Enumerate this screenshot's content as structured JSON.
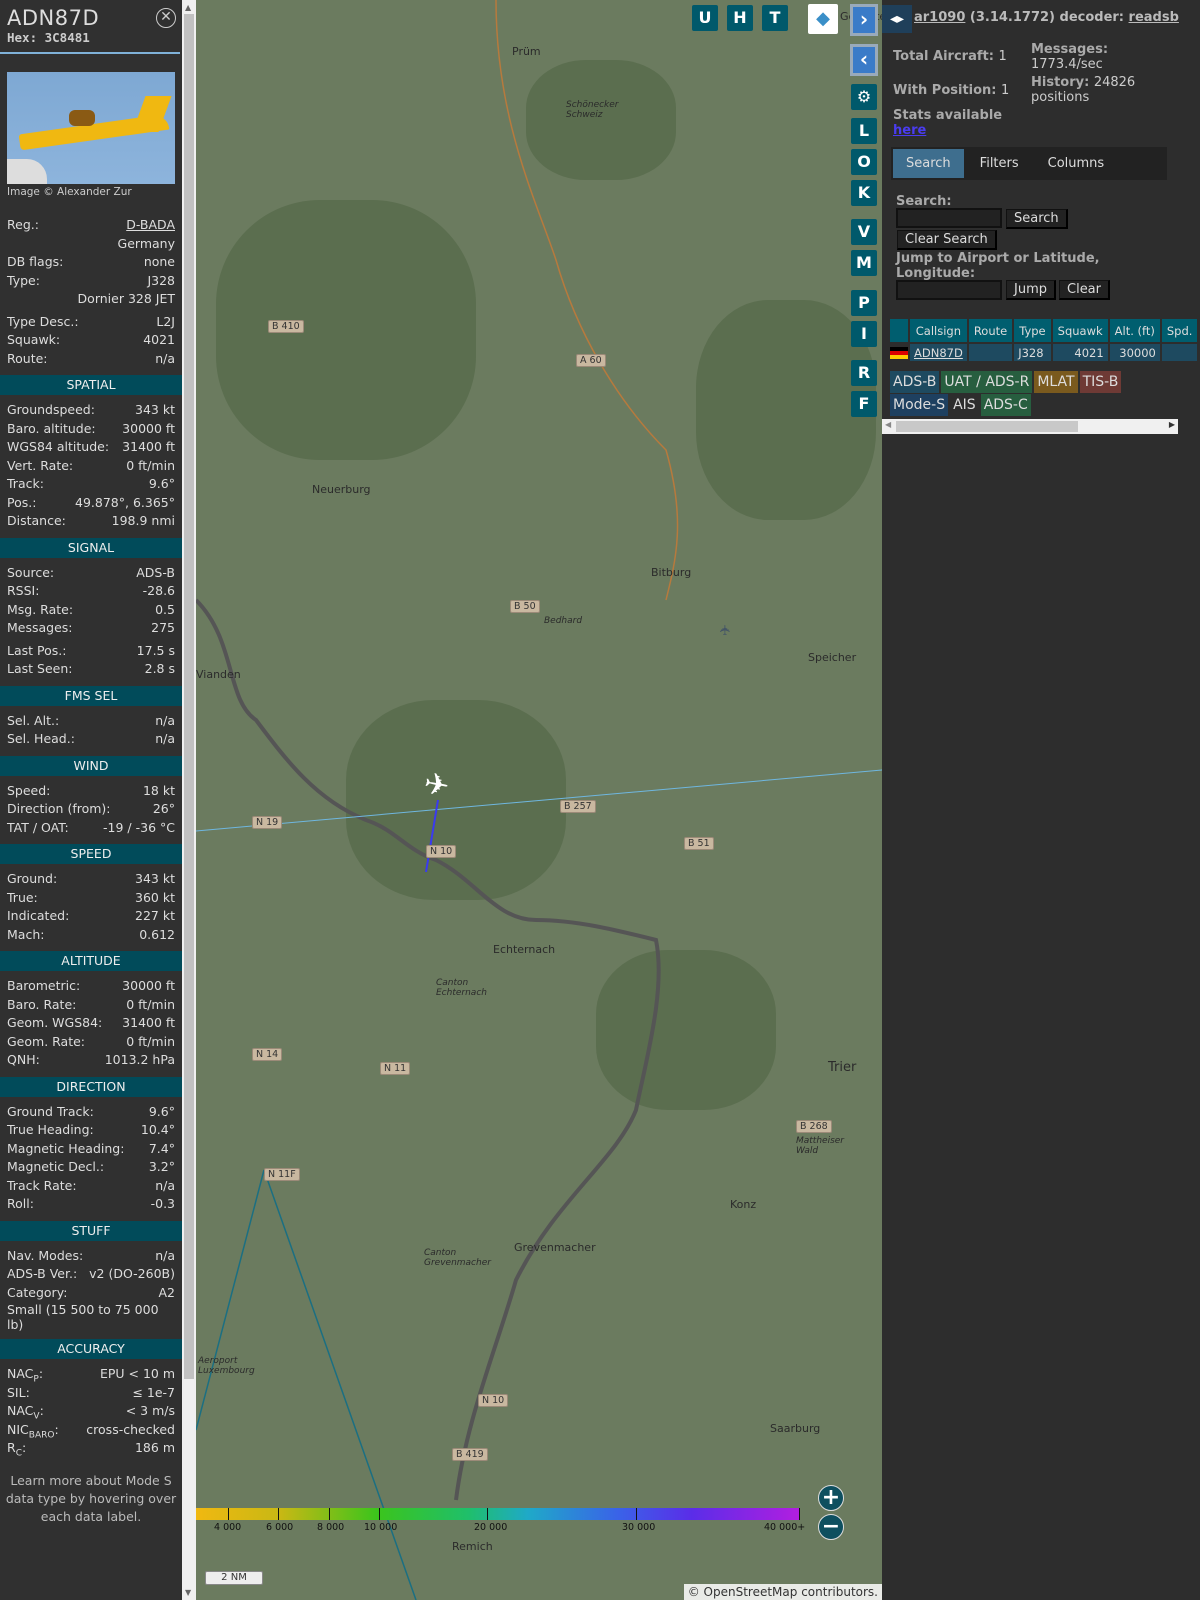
{
  "sidebar": {
    "callsign": "ADN87D",
    "hex": "Hex: 3C8481",
    "image_credit": "Image © Alexander Zur",
    "top_rows": [
      {
        "label": "Reg.:",
        "value": "D-BADA",
        "link": true
      },
      {
        "label": "",
        "value": "Germany"
      },
      {
        "label": "DB flags:",
        "value": "none"
      },
      {
        "label": "Type:",
        "value": "J328"
      },
      {
        "label": "",
        "value": "Dornier 328 JET"
      },
      {
        "gap": true
      },
      {
        "label": "Type Desc.:",
        "value": "L2J"
      },
      {
        "label": "Squawk:",
        "value": "4021"
      },
      {
        "label": "Route:",
        "value": "n/a"
      }
    ],
    "sections": [
      {
        "title": "SPATIAL",
        "rows": [
          {
            "label": "Groundspeed:",
            "value": "343 kt"
          },
          {
            "label": "Baro. altitude:",
            "value": "30000 ft"
          },
          {
            "label": "WGS84 altitude:",
            "value": "31400 ft"
          },
          {
            "label": "Vert. Rate:",
            "value": "0 ft/min"
          },
          {
            "label": "Track:",
            "value": "9.6°"
          },
          {
            "label": "Pos.:",
            "value": "49.878°, 6.365°"
          },
          {
            "label": "Distance:",
            "value": "198.9 nmi"
          }
        ]
      },
      {
        "title": "SIGNAL",
        "rows": [
          {
            "label": "Source:",
            "value": "ADS-B"
          },
          {
            "label": "RSSI:",
            "value": "-28.6"
          },
          {
            "label": "Msg. Rate:",
            "value": "0.5"
          },
          {
            "label": "Messages:",
            "value": "275"
          },
          {
            "gap": true
          },
          {
            "label": "Last Pos.:",
            "value": "17.5 s"
          },
          {
            "label": "Last Seen:",
            "value": "2.8 s"
          }
        ]
      },
      {
        "title": "FMS SEL",
        "rows": [
          {
            "label": "Sel. Alt.:",
            "value": "n/a"
          },
          {
            "label": "Sel. Head.:",
            "value": "n/a"
          }
        ]
      },
      {
        "title": "WIND",
        "rows": [
          {
            "label": "Speed:",
            "value": "18 kt"
          },
          {
            "label": "Direction (from):",
            "value": "26°"
          },
          {
            "label": "TAT / OAT:",
            "value": "-19 / -36 °C"
          }
        ]
      },
      {
        "title": "SPEED",
        "rows": [
          {
            "label": "Ground:",
            "value": "343 kt"
          },
          {
            "label": "True:",
            "value": "360 kt"
          },
          {
            "label": "Indicated:",
            "value": "227 kt"
          },
          {
            "label": "Mach:",
            "value": "0.612"
          }
        ]
      },
      {
        "title": "ALTITUDE",
        "rows": [
          {
            "label": "Barometric:",
            "value": "30000 ft"
          },
          {
            "label": "Baro. Rate:",
            "value": "0 ft/min"
          },
          {
            "label": "Geom. WGS84:",
            "value": "31400 ft"
          },
          {
            "label": "Geom. Rate:",
            "value": "0 ft/min"
          },
          {
            "label": "QNH:",
            "value": "1013.2 hPa"
          }
        ]
      },
      {
        "title": "DIRECTION",
        "rows": [
          {
            "label": "Ground Track:",
            "value": "9.6°"
          },
          {
            "label": "True Heading:",
            "value": "10.4°"
          },
          {
            "label": "Magnetic Heading:",
            "value": "7.4°"
          },
          {
            "label": "Magnetic Decl.:",
            "value": "3.2°"
          },
          {
            "label": "Track Rate:",
            "value": "n/a"
          },
          {
            "label": "Roll:",
            "value": "-0.3"
          }
        ]
      },
      {
        "title": "STUFF",
        "rows": [
          {
            "label": "Nav. Modes:",
            "value": "n/a"
          },
          {
            "label": "ADS-B Ver.:",
            "value": "v2 (DO-260B)"
          },
          {
            "label": "Category:",
            "value": "A2"
          },
          {
            "label": "Small (15 500 to 75 000 lb)",
            "value": "",
            "wrap": true
          }
        ]
      },
      {
        "title": "ACCURACY",
        "rows": [
          {
            "label": "NAC",
            "sub": "P",
            "value": "EPU < 10 m"
          },
          {
            "label": "SIL:",
            "value": "≤ 1e-7"
          },
          {
            "label": "NAC",
            "sub": "V",
            "value": "< 3 m/s"
          },
          {
            "label": "NIC",
            "sub": "BARO",
            "value": "cross-checked"
          },
          {
            "label": "R",
            "sub": "C",
            "value": "186 m"
          }
        ]
      }
    ],
    "learn_more": "Learn more about Mode S data type by hovering over each data label."
  },
  "map": {
    "top_buttons": [
      "U",
      "H",
      "T"
    ],
    "side_buttons": [
      "L",
      "O",
      "K",
      "V",
      "M",
      "P",
      "I",
      "R",
      "F"
    ],
    "towns": [
      "Prüm",
      "Neuerburg",
      "Bitburg",
      "Speicher",
      "Vianden",
      "Echternach",
      "Trier",
      "Konz",
      "Grevenmacher",
      "Saarburg",
      "Remich",
      "Bedhard",
      "Schönecker Schweiz",
      "Canton Echternach",
      "Canton Grevenmacher",
      "Mattheiser Wald",
      "Aeroport Luxembourg",
      "Gerolstein"
    ],
    "roads": [
      "B 410",
      "A 60",
      "B 50",
      "B 257",
      "N 19",
      "N 10",
      "B 51",
      "N 14",
      "N 11",
      "B 268",
      "N 11F",
      "N 10",
      "B 419"
    ],
    "altitude_legend": [
      "4 000",
      "6 000",
      "8 000",
      "10 000",
      "20 000",
      "30 000",
      "40 000+"
    ],
    "scale": "2 NM",
    "attribution_prefix": "©",
    "attribution_link": "OpenStreetMap",
    "attribution_suffix": "contributors."
  },
  "panel": {
    "title_link": "ar1090",
    "title_version": "(3.14.1772) decoder:",
    "title_decoder": "readsb",
    "total_aircraft_label": "Total Aircraft:",
    "total_aircraft": "1",
    "with_position_label": "With Position:",
    "with_position": "1",
    "messages_label": "Messages:",
    "messages": "1773.4/sec",
    "history_label": "History:",
    "history": "24826 positions",
    "stats_label": "Stats available",
    "stats_link": "here",
    "tabs": [
      "Search",
      "Filters",
      "Columns"
    ],
    "search_label": "Search:",
    "search_placeholder": "",
    "search_button": "Search",
    "clear_search_button": "Clear Search",
    "jump_label": "Jump to Airport or Latitude, Longitude:",
    "jump_button": "Jump",
    "clear_button": "Clear",
    "table": {
      "headers": [
        "",
        "Callsign",
        "Route",
        "Type",
        "Squawk",
        "Alt. (ft)",
        "Spd."
      ],
      "rows": [
        {
          "callsign": "ADN87D",
          "route": "",
          "type": "J328",
          "squawk": "4021",
          "alt": "30000",
          "spd": ""
        }
      ]
    },
    "badges": [
      {
        "label": "ADS-B",
        "color": "#1e4a60"
      },
      {
        "label": "UAT / ADS-R",
        "color": "#275e3f"
      },
      {
        "label": "MLAT",
        "color": "#7a5a1e"
      },
      {
        "label": "TIS-B",
        "color": "#6e3a35"
      },
      {
        "label": "Mode-S",
        "color": "#1e4060"
      },
      {
        "label": "AIS",
        "color": "transparent"
      },
      {
        "label": "ADS-C",
        "color": "#275e3f"
      }
    ]
  }
}
